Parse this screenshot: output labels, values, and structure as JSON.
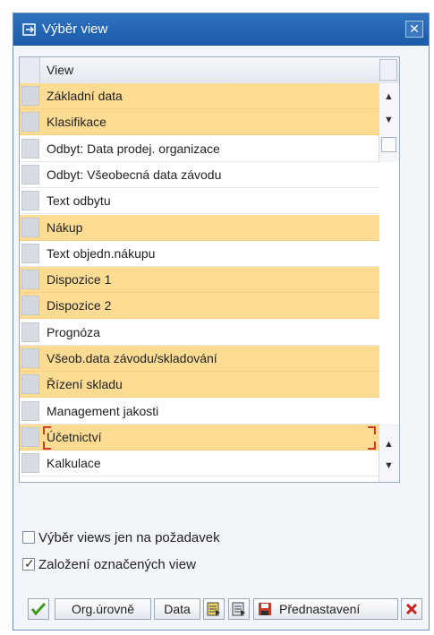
{
  "window": {
    "title": "Výběr view",
    "close_glyph": "✕"
  },
  "table": {
    "column_header": "View",
    "rows": [
      {
        "label": "Základní data",
        "selected": true
      },
      {
        "label": "Klasifikace",
        "selected": true
      },
      {
        "label": "Odbyt: Data prodej. organizace",
        "selected": false
      },
      {
        "label": "Odbyt: Všeobecná data závodu",
        "selected": false
      },
      {
        "label": "Text odbytu",
        "selected": false
      },
      {
        "label": "Nákup",
        "selected": true
      },
      {
        "label": "Text objedn.nákupu",
        "selected": false
      },
      {
        "label": "Dispozice 1",
        "selected": true
      },
      {
        "label": "Dispozice 2",
        "selected": true
      },
      {
        "label": "Prognóza",
        "selected": false
      },
      {
        "label": "Všeob.data závodu/skladování",
        "selected": true
      },
      {
        "label": "Řízení skladu",
        "selected": true
      },
      {
        "label": "Management jakosti",
        "selected": false
      },
      {
        "label": "Účetnictví",
        "selected": true
      },
      {
        "label": "Kalkulace",
        "selected": false
      }
    ]
  },
  "options": {
    "views_on_demand": {
      "label": "Výběr views jen na požadavek",
      "checked": false
    },
    "create_selected": {
      "label": "Založení označených view",
      "checked": true
    }
  },
  "toolbar": {
    "org_levels": "Org.úrovně",
    "data": "Data",
    "defaults": "Přednastavení"
  },
  "colors": {
    "highlight": "#fcdc93",
    "title_bar": "#1b5ba8",
    "accept": "#3f9a1c",
    "cancel": "#cc2222"
  }
}
